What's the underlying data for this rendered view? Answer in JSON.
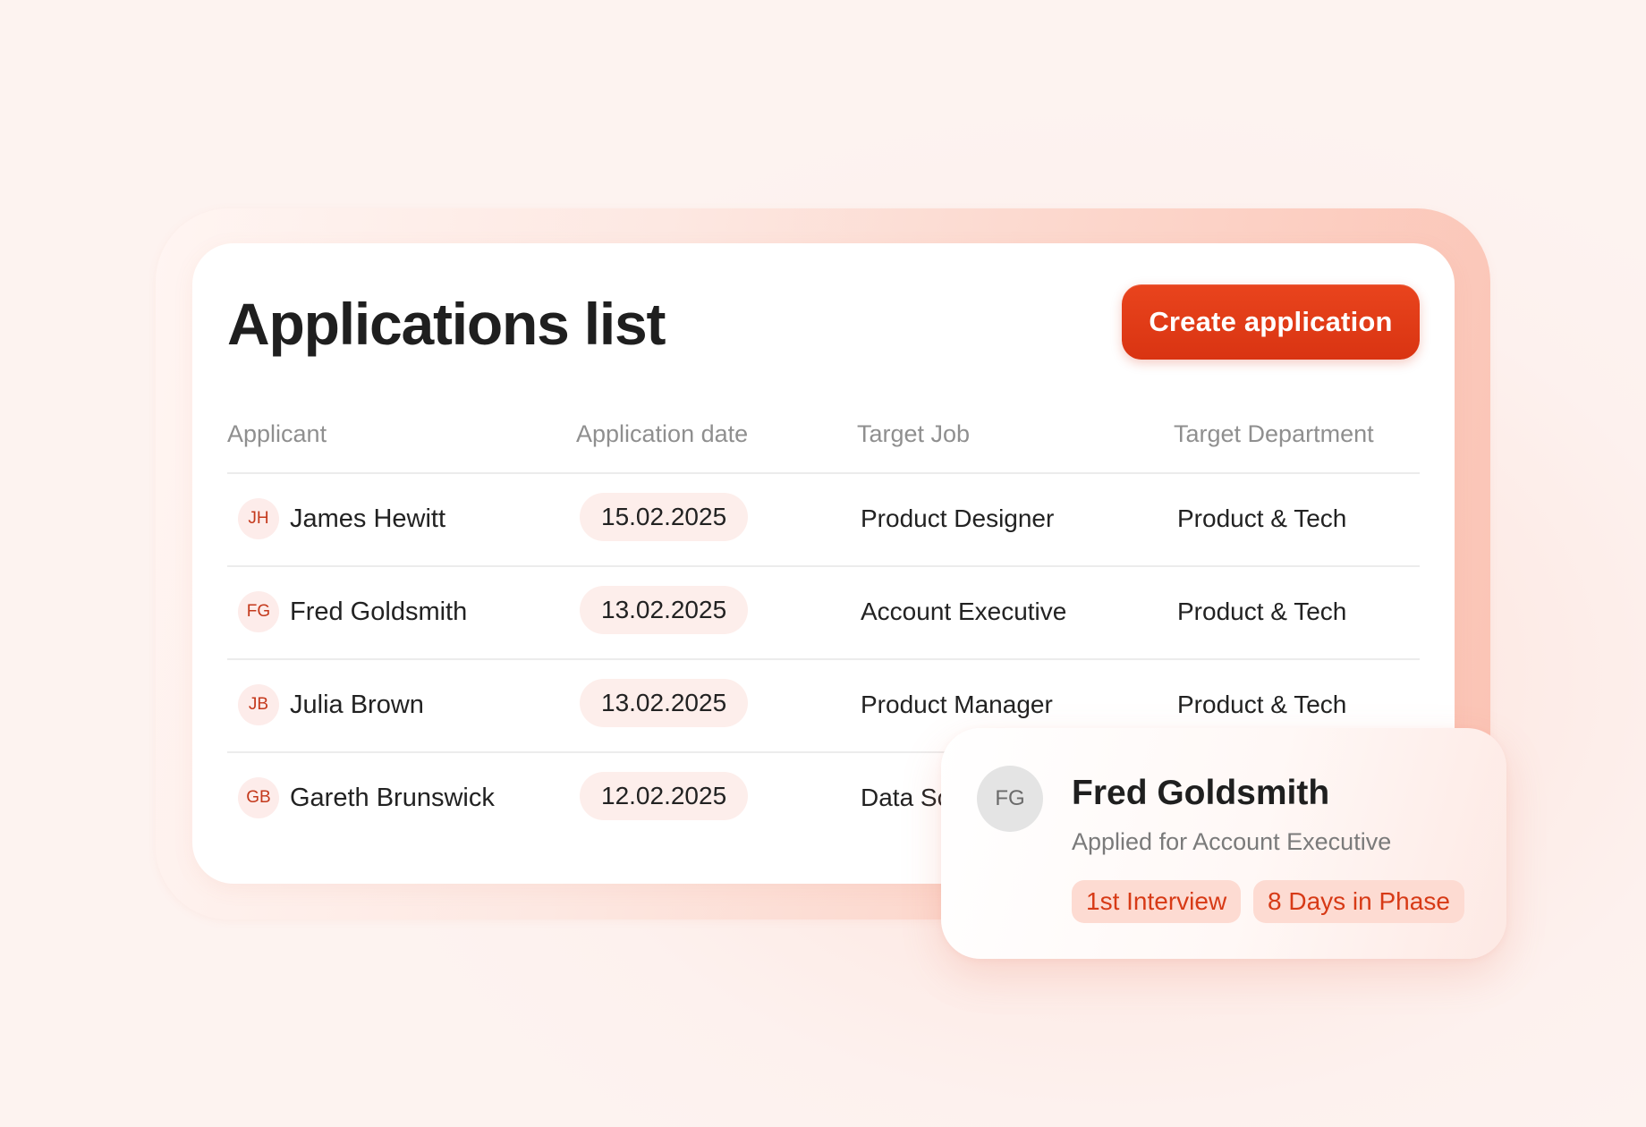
{
  "header": {
    "title": "Applications list",
    "create_button_label": "Create application"
  },
  "table": {
    "columns": [
      "Applicant",
      "Application date",
      "Target Job",
      "Target Department"
    ],
    "rows": [
      {
        "initials": "JH",
        "name": "James Hewitt",
        "date": "15.02.2025",
        "job": "Product Designer",
        "department": "Product & Tech"
      },
      {
        "initials": "FG",
        "name": "Fred Goldsmith",
        "date": "13.02.2025",
        "job": "Account Executive",
        "department": "Product & Tech"
      },
      {
        "initials": "JB",
        "name": "Julia Brown",
        "date": "13.02.2025",
        "job": "Product Manager",
        "department": "Product & Tech"
      },
      {
        "initials": "GB",
        "name": "Gareth Brunswick",
        "date": "12.02.2025",
        "job": "Data Sc",
        "department": ""
      }
    ]
  },
  "popup": {
    "initials": "FG",
    "name": "Fred Goldsmith",
    "subtitle": "Applied for Account Executive",
    "tags": [
      "1st Interview",
      "8 Days in Phase"
    ]
  },
  "colors": {
    "accent": "#e03a15",
    "pill_background": "#fdeeeb",
    "tag_background": "#fddbd2",
    "tag_text": "#d73a16"
  }
}
